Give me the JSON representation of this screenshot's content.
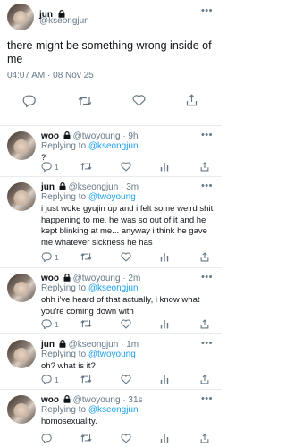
{
  "main_tweet": {
    "name": "jun",
    "handle": "@kseongjun",
    "text": "there might be something wrong inside of me",
    "meta": "04:07 AM · 08 Nov 25"
  },
  "replies": [
    {
      "name": "woo",
      "handle": "@twoyoung",
      "time": "· 9h",
      "replying_label": "Replying to",
      "replying_to": "@kseongjun",
      "text": "?",
      "reply_count": "1"
    },
    {
      "name": "jun",
      "handle": "@kseongjun",
      "time": "· 3m",
      "replying_label": "Replying to",
      "replying_to": "@twoyoung",
      "text": "i just woke gyujin up and i felt some weird shit happening to me. he was so out of it and he kept blinking at me... anyway i think he gave me whatever sickness he has",
      "reply_count": "1"
    },
    {
      "name": "woo",
      "handle": "@twoyoung",
      "time": "· 2m",
      "replying_label": "Replying to",
      "replying_to": "@kseongjun",
      "text": "ohh i've heard of that actually, i know what you're coming down with",
      "reply_count": "1"
    },
    {
      "name": "jun",
      "handle": "@kseongjun",
      "time": "· 1m",
      "replying_label": "Replying to",
      "replying_to": "@twoyoung",
      "text": "oh? what is it?",
      "reply_count": "1"
    },
    {
      "name": "woo",
      "handle": "@twoyoung",
      "time": "· 31s",
      "replying_label": "Replying to",
      "replying_to": "@kseongjun",
      "text": "homosexuality.",
      "reply_count": ""
    }
  ],
  "icons": [
    "lock-icon",
    "more-icon",
    "reply-icon",
    "retweet-icon",
    "like-icon",
    "analytics-icon",
    "share-icon"
  ],
  "colors": {
    "link": "#1da1f2",
    "muted": "#657786",
    "divider": "#e6ecf0"
  }
}
